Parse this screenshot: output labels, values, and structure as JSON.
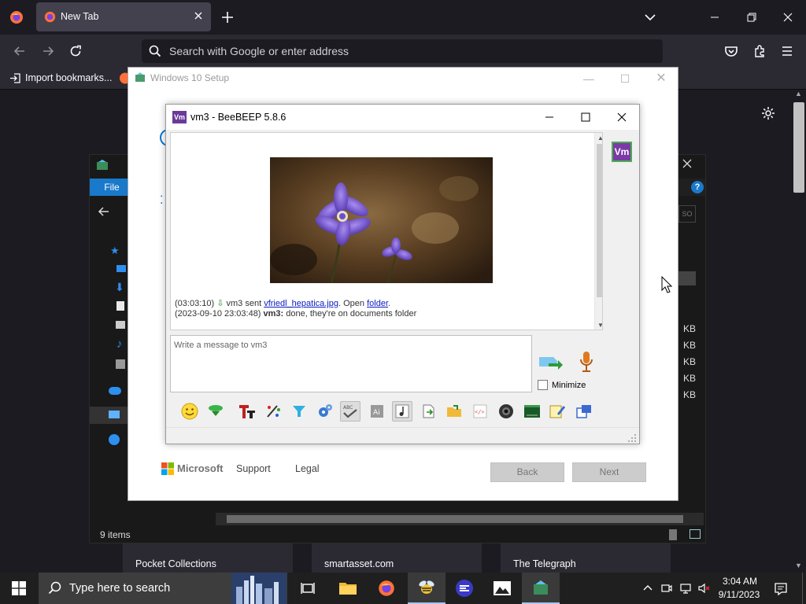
{
  "browser": {
    "tab_title": "New Tab",
    "new_tab_symbol": "+",
    "url_placeholder": "Search with Google or enter address",
    "bookmark_import": "Import bookmarks...",
    "icons": [
      "firefox-icon",
      "close-icon",
      "new-tab-icon",
      "list-all-tabs-icon",
      "back-icon",
      "forward-icon",
      "reload-icon",
      "search-icon",
      "pocket-icon",
      "extensions-icon",
      "menu-icon",
      "settings-icon"
    ]
  },
  "setup": {
    "title": "Windows 10 Setup",
    "brand": "Microsoft",
    "support_link": "Support",
    "legal_link": "Legal",
    "back_button": "Back",
    "next_button": "Next"
  },
  "explorer": {
    "file_tab": "File",
    "status_items": "9 items",
    "file_sizes": [
      "KB",
      "KB",
      "KB",
      "KB",
      "KB"
    ]
  },
  "beebeep": {
    "title": "vm3 - BeeBEEP 5.8.6",
    "app_badge": "Vm",
    "avatar_label": "Vm",
    "messages": {
      "sent_time": "(03:03:10)",
      "sent_prefix": "vm3 sent",
      "sent_file": "vfriedl_hepatica.jpg",
      "sent_open": ". Open",
      "sent_folder": "folder",
      "sent_end": ".",
      "reply_time": "(2023-09-10 23:03:48)",
      "reply_user": "vm3:",
      "reply_text": "done, they're on documents folder"
    },
    "input_placeholder": "Write a message to vm3",
    "minimize_label": "Minimize",
    "toolbar_icons": [
      "emoticon-icon",
      "save-icon",
      "font-icon",
      "color-icon",
      "filter-icon",
      "settings-icon",
      "spellcheck-icon",
      "completer-icon",
      "music-icon",
      "send-file-icon",
      "folder-icon",
      "code-icon",
      "screenshot-icon",
      "terminal-icon",
      "note-icon",
      "share-icon"
    ]
  },
  "partial_cards": [
    "Pocket Collections",
    "smartasset.com",
    "The Telegraph"
  ],
  "taskbar": {
    "search_placeholder": "Type here to search",
    "time": "3:04 AM",
    "date": "9/11/2023",
    "tray_icons": [
      "chevron-up-icon",
      "meet-now-icon",
      "network-icon",
      "volume-muted-icon",
      "notifications-icon"
    ]
  }
}
